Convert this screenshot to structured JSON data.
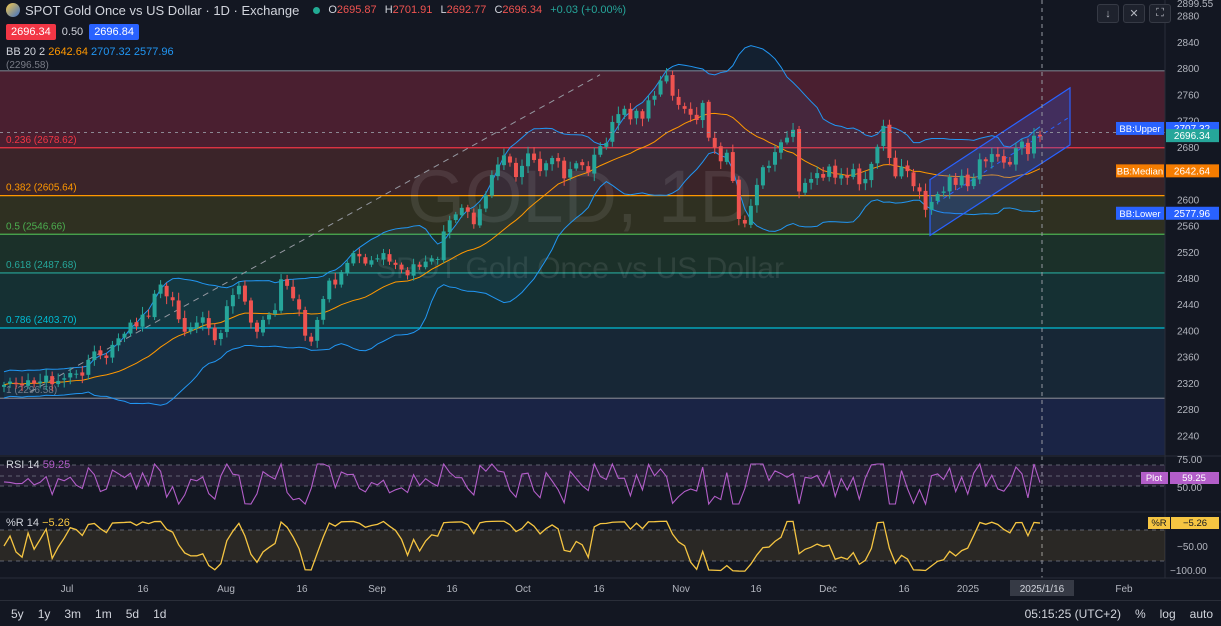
{
  "header": {
    "symbol_title": "SPOT Gold Once vs US Dollar · 1D · Exchange",
    "ohlc": [
      {
        "k": "O",
        "v": "2695.87"
      },
      {
        "k": "H",
        "v": "2701.91"
      },
      {
        "k": "L",
        "v": "2692.77"
      },
      {
        "k": "C",
        "v": "2696.34"
      }
    ],
    "change": "+0.03 (+0.00%)",
    "sell_price": "2696.34",
    "spread": "0.50",
    "buy_price": "2696.84",
    "bb_label": "BB 20 2",
    "bb_basis": "2642.64",
    "bb_upper": "2707.32",
    "bb_lower": "2577.96",
    "prev_label": "(2296.58)"
  },
  "toolbar": {
    "download_icon": "↓",
    "close_icon": "✕",
    "fullscreen_icon": "⛶"
  },
  "watermark": {
    "big": "GOLD, 1D",
    "small": "SPOT Gold Once vs US Dollar"
  },
  "colors": {
    "bg": "#131722",
    "up": "#26a69a",
    "down": "#ef5350",
    "bb_band": "#2196f3",
    "bb_mid": "#ff9800",
    "rsi": "#b35ec9",
    "wr": "#f5c542",
    "channel": "#2962ff"
  },
  "fib_levels": [
    {
      "ratio": 0,
      "price": 2796.0,
      "label": "",
      "line": "#787b86",
      "fill": "#5d2336"
    },
    {
      "ratio": 0.236,
      "price": 2678.62,
      "label": "0.236 (2678.62)",
      "line": "#f23645",
      "fill": "#4a2a2c"
    },
    {
      "ratio": 0.382,
      "price": 2605.64,
      "label": "0.382 (2605.64)",
      "line": "#ff9800",
      "fill": "#3a3a22"
    },
    {
      "ratio": 0.5,
      "price": 2546.66,
      "label": "0.5 (2546.66)",
      "line": "#4caf50",
      "fill": "#1f3a2c"
    },
    {
      "ratio": 0.618,
      "price": 2487.68,
      "label": "0.618 (2487.68)",
      "line": "#26a69a",
      "fill": "#173a3a"
    },
    {
      "ratio": 0.786,
      "price": 2403.7,
      "label": "0.786 (2403.70)",
      "line": "#00bcd4",
      "fill": "#1a2e3d"
    },
    {
      "ratio": 1,
      "price": 2296.58,
      "label": "1 (2296.58)",
      "line": "#787b86",
      "fill": "#1d2a52"
    }
  ],
  "chart_data": {
    "type": "candlestick",
    "title": "SPOT Gold Once vs US Dollar · 1D · Exchange",
    "watermark": "GOLD, 1D",
    "y_ticks": [
      2899.55,
      2880,
      2840,
      2800,
      2760,
      2720,
      2680,
      2640,
      2600,
      2560,
      2520,
      2480,
      2440,
      2400,
      2360,
      2320,
      2280,
      2240
    ],
    "ylim": [
      2210,
      2904
    ],
    "x_ticks": [
      "Jul",
      "16",
      "Aug",
      "16",
      "Sep",
      "16",
      "Oct",
      "16",
      "Nov",
      "16",
      "Dec",
      "16",
      "2025",
      "Feb"
    ],
    "crosshair_date": "2025/1/16",
    "candles_close_series": [
      2317,
      2322,
      2318,
      2316,
      2324,
      2319,
      2322,
      2331,
      2318,
      2323,
      2327,
      2335,
      2334,
      2331,
      2355,
      2368,
      2362,
      2358,
      2378,
      2388,
      2395,
      2412,
      2406,
      2424,
      2421,
      2456,
      2470,
      2452,
      2446,
      2417,
      2398,
      2405,
      2412,
      2420,
      2404,
      2385,
      2396,
      2437,
      2454,
      2468,
      2444,
      2412,
      2398,
      2416,
      2424,
      2431,
      2478,
      2468,
      2449,
      2432,
      2392,
      2383,
      2416,
      2448,
      2476,
      2470,
      2489,
      2503,
      2518,
      2513,
      2502,
      2507,
      2510,
      2518,
      2505,
      2500,
      2493,
      2484,
      2501,
      2497,
      2505,
      2510,
      2509,
      2551,
      2568,
      2577,
      2587,
      2581,
      2562,
      2585,
      2606,
      2637,
      2653,
      2667,
      2656,
      2634,
      2651,
      2670,
      2660,
      2643,
      2655,
      2663,
      2658,
      2632,
      2646,
      2655,
      2652,
      2641,
      2668,
      2681,
      2686,
      2718,
      2730,
      2738,
      2722,
      2735,
      2723,
      2751,
      2758,
      2781,
      2789,
      2758,
      2744,
      2738,
      2729,
      2721,
      2747,
      2694,
      2679,
      2658,
      2671,
      2628,
      2570,
      2563,
      2590,
      2622,
      2649,
      2651,
      2672,
      2687,
      2694,
      2706,
      2612,
      2625,
      2631,
      2640,
      2633,
      2650,
      2633,
      2637,
      2633,
      2646,
      2623,
      2631,
      2654,
      2680,
      2712,
      2663,
      2635,
      2650,
      2643,
      2620,
      2612,
      2584,
      2596,
      2608,
      2612,
      2634,
      2622,
      2636,
      2620,
      2632,
      2661,
      2658,
      2669,
      2665,
      2656,
      2653,
      2678,
      2688,
      2669,
      2697,
      2696
    ],
    "bb": {
      "upper": 2707.32,
      "basis": 2642.64,
      "lower": 2577.96
    },
    "right_labels": [
      {
        "text": "BB:Upper",
        "value": "2707.32",
        "price": 2707.32,
        "bg": "#2962ff"
      },
      {
        "text": "",
        "value": "2696.34",
        "price": 2696.34,
        "bg": "#26a69a"
      },
      {
        "text": "BB:Median",
        "value": "2642.64",
        "price": 2642.64,
        "bg": "#f57c00"
      },
      {
        "text": "BB:Lower",
        "value": "2577.96",
        "price": 2577.96,
        "bg": "#2962ff"
      }
    ],
    "rsi": {
      "label": "RSI 14",
      "value": "59.25",
      "tag": "Plot",
      "ticks": [
        "75.00",
        "50.00"
      ],
      "levels": [
        70,
        50,
        30
      ],
      "last": 59.25
    },
    "williams_r": {
      "label": "%R 14",
      "value": "−5.26",
      "tag": "%R",
      "ticks": [
        "−50.00",
        "−100.00"
      ],
      "levels": [
        -20,
        -80
      ],
      "last": -5.26
    }
  },
  "bottom": {
    "timeframes": [
      "5y",
      "1y",
      "3m",
      "1m",
      "5d",
      "1d"
    ],
    "clock": "05:15:25 (UTC+2)",
    "percent": "%",
    "log": "log",
    "auto": "auto"
  }
}
